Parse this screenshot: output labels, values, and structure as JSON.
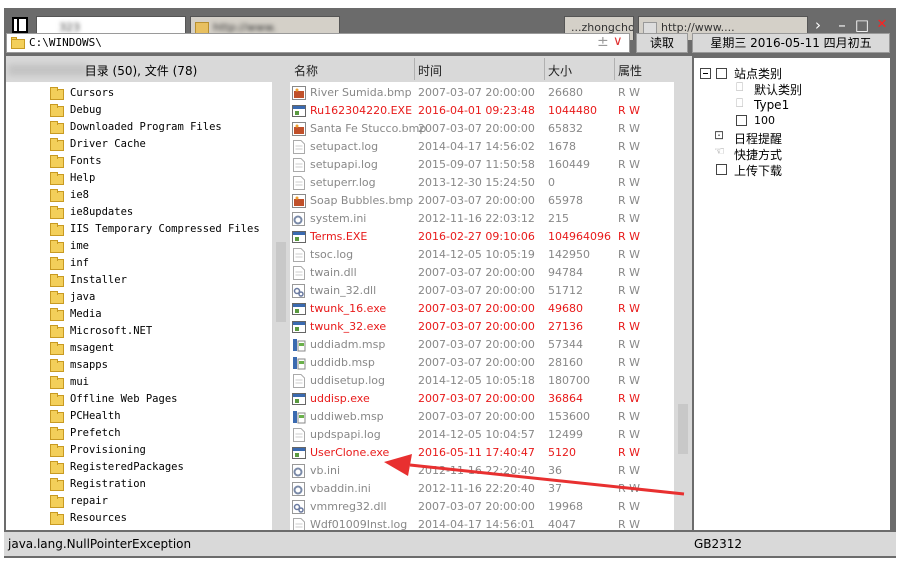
{
  "titlebar": {
    "tabs": [
      {
        "label": "                      323"
      },
      {
        "label": "http://www.                "
      },
      {
        "label": "...zhongchouti..."
      },
      {
        "label": "http://www...."
      }
    ],
    "buttons": {
      "forward": "›",
      "minimize": "–",
      "maximize": "□",
      "close": "✕"
    }
  },
  "address": {
    "path": "C:\\WINDOWS\\"
  },
  "toolbar": {
    "read_label": "读取",
    "date_label": "星期三 2016-05-11 四月初五"
  },
  "left": {
    "count_label": "目录 (50), 文件 (78)",
    "folders": [
      "Cursors",
      "Debug",
      "Downloaded Program Files",
      "Driver Cache",
      "Fonts",
      "Help",
      "ie8",
      "ie8updates",
      "IIS Temporary Compressed Files",
      "ime",
      "inf",
      "Installer",
      "java",
      "Media",
      "Microsoft.NET",
      "msagent",
      "msapps",
      "mui",
      "Offline Web Pages",
      "PCHealth",
      "Prefetch",
      "Provisioning",
      "RegisteredPackages",
      "Registration",
      "repair",
      "Resources"
    ]
  },
  "files": {
    "columns": {
      "name": "名称",
      "time": "时间",
      "size": "大小",
      "attr": "属性"
    },
    "rows": [
      {
        "name": "River Sumida.bmp",
        "time": "2007-03-07 20:00:00",
        "size": "26680",
        "attr": "R W",
        "icon": "bmp-icon",
        "red": false
      },
      {
        "name": "Ru162304220.EXE",
        "time": "2016-04-01 09:23:48",
        "size": "1044480",
        "attr": "R W",
        "icon": "exe-icon",
        "red": true
      },
      {
        "name": "Santa Fe Stucco.bmp",
        "time": "2007-03-07 20:00:00",
        "size": "65832",
        "attr": "R W",
        "icon": "bmp-icon",
        "red": false
      },
      {
        "name": "setupact.log",
        "time": "2014-04-17 14:56:02",
        "size": "1678",
        "attr": "R W",
        "icon": "doc-icon",
        "red": false
      },
      {
        "name": "setupapi.log",
        "time": "2015-09-07 11:50:58",
        "size": "160449",
        "attr": "R W",
        "icon": "doc-icon",
        "red": false
      },
      {
        "name": "setuperr.log",
        "time": "2013-12-30 15:24:50",
        "size": "0",
        "attr": "R W",
        "icon": "doc-icon",
        "red": false
      },
      {
        "name": "Soap Bubbles.bmp",
        "time": "2007-03-07 20:00:00",
        "size": "65978",
        "attr": "R W",
        "icon": "bmp-icon",
        "red": false
      },
      {
        "name": "system.ini",
        "time": "2012-11-16 22:03:12",
        "size": "215",
        "attr": "R W",
        "icon": "ini-icon",
        "red": false
      },
      {
        "name": "Terms.EXE",
        "time": "2016-02-27 09:10:06",
        "size": "104964096",
        "attr": "R W",
        "icon": "exe-icon",
        "red": true
      },
      {
        "name": "tsoc.log",
        "time": "2014-12-05 10:05:19",
        "size": "142950",
        "attr": "R W",
        "icon": "doc-icon",
        "red": false
      },
      {
        "name": "twain.dll",
        "time": "2007-03-07 20:00:00",
        "size": "94784",
        "attr": "R W",
        "icon": "doc-icon",
        "red": false
      },
      {
        "name": "twain_32.dll",
        "time": "2007-03-07 20:00:00",
        "size": "51712",
        "attr": "R W",
        "icon": "dll-icon",
        "red": false
      },
      {
        "name": "twunk_16.exe",
        "time": "2007-03-07 20:00:00",
        "size": "49680",
        "attr": "R W",
        "icon": "exe-icon",
        "red": true
      },
      {
        "name": "twunk_32.exe",
        "time": "2007-03-07 20:00:00",
        "size": "27136",
        "attr": "R W",
        "icon": "exe-icon",
        "red": true
      },
      {
        "name": "uddiadm.msp",
        "time": "2007-03-07 20:00:00",
        "size": "57344",
        "attr": "R W",
        "icon": "msp-icon",
        "red": false
      },
      {
        "name": "uddidb.msp",
        "time": "2007-03-07 20:00:00",
        "size": "28160",
        "attr": "R W",
        "icon": "msp-icon",
        "red": false
      },
      {
        "name": "uddisetup.log",
        "time": "2014-12-05 10:05:18",
        "size": "180700",
        "attr": "R W",
        "icon": "doc-icon",
        "red": false
      },
      {
        "name": "uddisp.exe",
        "time": "2007-03-07 20:00:00",
        "size": "36864",
        "attr": "R W",
        "icon": "exe-icon",
        "red": true
      },
      {
        "name": "uddiweb.msp",
        "time": "2007-03-07 20:00:00",
        "size": "153600",
        "attr": "R W",
        "icon": "msp-icon",
        "red": false
      },
      {
        "name": "updspapi.log",
        "time": "2014-12-05 10:04:57",
        "size": "12499",
        "attr": "R W",
        "icon": "doc-icon",
        "red": false
      },
      {
        "name": "UserClone.exe",
        "time": "2016-05-11 17:40:47",
        "size": "5120",
        "attr": "R W",
        "icon": "exe-icon",
        "red": true
      },
      {
        "name": "vb.ini",
        "time": "2012-11-16 22:20:40",
        "size": "36",
        "attr": "R W",
        "icon": "ini-icon",
        "red": false
      },
      {
        "name": "vbaddin.ini",
        "time": "2012-11-16 22:20:40",
        "size": "37",
        "attr": "R W",
        "icon": "ini-icon",
        "red": false
      },
      {
        "name": "vmmreg32.dll",
        "time": "2007-03-07 20:00:00",
        "size": "19968",
        "attr": "R W",
        "icon": "dll-icon",
        "red": false
      },
      {
        "name": "Wdf01009Inst.log",
        "time": "2014-04-17 14:56:01",
        "size": "4047",
        "attr": "R W",
        "icon": "doc-icon",
        "red": false
      }
    ]
  },
  "tree": {
    "root": "站点类别",
    "children": [
      "默认类别",
      "Type1",
      "100"
    ],
    "others": [
      "日程提醒",
      "快捷方式",
      "上传下载"
    ]
  },
  "status": {
    "message": "java.lang.NullPointerException",
    "encoding": "GB2312"
  },
  "colors": {
    "red_text": "#e81a1a",
    "grey_text": "#888888",
    "arrow": "#e83030"
  }
}
